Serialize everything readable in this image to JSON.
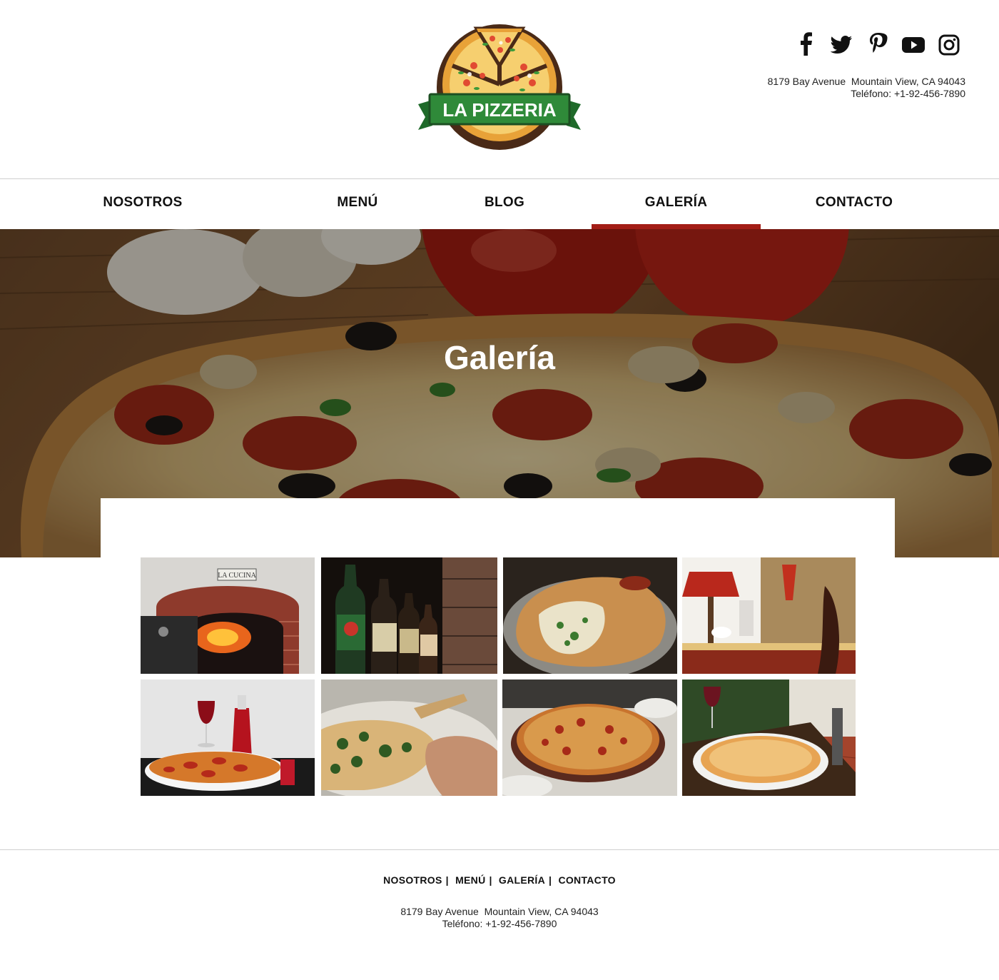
{
  "brand": {
    "logo_text": "LA PIZZERIA"
  },
  "header": {
    "social": [
      "facebook-icon",
      "twitter-icon",
      "pinterest-icon",
      "youtube-icon",
      "instagram-icon"
    ],
    "address": "8179 Bay Avenue  Mountain View, CA 94043",
    "phone": "Teléfono: +1-92-456-7890"
  },
  "nav": {
    "items": [
      "NOSOTROS",
      "MENÚ",
      "BLOG",
      "GALERÍA",
      "CONTACTO"
    ],
    "active": "GALERÍA",
    "accent": "#a31d16"
  },
  "hero": {
    "title": "Galería"
  },
  "gallery": {
    "images": [
      "brick-oven",
      "beer-bottles",
      "calzone",
      "dining-table",
      "pizza-wine",
      "spinach-pizza",
      "pizza-table",
      "patio-pizza"
    ]
  },
  "footer": {
    "links": [
      "NOSOTROS",
      "MENÚ",
      "GALERÍA",
      "CONTACTO"
    ],
    "address": "8179 Bay Avenue  Mountain View, CA 94043",
    "phone": "Teléfono: +1-92-456-7890"
  }
}
